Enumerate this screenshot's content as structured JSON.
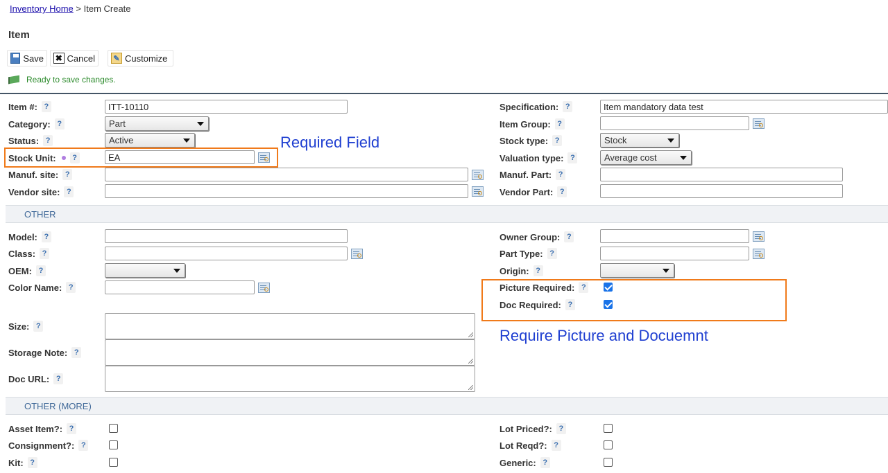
{
  "breadcrumb": {
    "home": "Inventory Home",
    "separator": ">",
    "current": "Item Create"
  },
  "page_title": "Item",
  "toolbar": {
    "save": "Save",
    "cancel": "Cancel",
    "customize": "Customize"
  },
  "status_message": "Ready to save changes.",
  "main": {
    "left": {
      "item_no": {
        "label": "Item #:",
        "value": "ITT-10110"
      },
      "category": {
        "label": "Category:",
        "value": "Part"
      },
      "status": {
        "label": "Status:",
        "value": "Active"
      },
      "stock_unit": {
        "label": "Stock Unit:",
        "value": "EA"
      },
      "manuf_site": {
        "label": "Manuf. site:",
        "value": ""
      },
      "vendor_site": {
        "label": "Vendor site:",
        "value": ""
      }
    },
    "right": {
      "specification": {
        "label": "Specification:",
        "value": "Item mandatory data test"
      },
      "item_group": {
        "label": "Item Group:",
        "value": ""
      },
      "stock_type": {
        "label": "Stock type:",
        "value": "Stock"
      },
      "valuation_type": {
        "label": "Valuation type:",
        "value": "Average cost"
      },
      "manuf_part": {
        "label": "Manuf. Part:",
        "value": ""
      },
      "vendor_part": {
        "label": "Vendor Part:",
        "value": ""
      }
    }
  },
  "other": {
    "title": "OTHER",
    "model": {
      "label": "Model:",
      "value": ""
    },
    "class": {
      "label": "Class:",
      "value": ""
    },
    "oem": {
      "label": "OEM:",
      "value": ""
    },
    "color_name": {
      "label": "Color Name:",
      "value": ""
    },
    "size": {
      "label": "Size:"
    },
    "storage_note": {
      "label": "Storage Note:"
    },
    "doc_url": {
      "label": "Doc URL:"
    },
    "owner_group": {
      "label": "Owner Group:",
      "value": ""
    },
    "part_type": {
      "label": "Part Type:",
      "value": ""
    },
    "origin": {
      "label": "Origin:",
      "value": ""
    },
    "picture_required": {
      "label": "Picture Required:",
      "checked": true
    },
    "doc_required": {
      "label": "Doc Required:",
      "checked": true
    }
  },
  "other_more": {
    "title": "OTHER (MORE)",
    "asset_item": {
      "label": "Asset Item?:",
      "checked": false
    },
    "consignment": {
      "label": "Consignment?:",
      "checked": false
    },
    "kit": {
      "label": "Kit:",
      "checked": false
    },
    "lot_priced": {
      "label": "Lot Priced?:",
      "checked": false
    },
    "lot_reqd": {
      "label": "Lot Reqd?:",
      "checked": false
    },
    "generic": {
      "label": "Generic:",
      "checked": false
    }
  },
  "help_glyph": "?",
  "annotations": {
    "required_field": "Required Field",
    "require_picture_doc": "Require Picture and Docuemnt"
  },
  "colors": {
    "accent_blue": "#1a73e8",
    "annotation_orange": "#f07a1a",
    "annotation_text": "#1f3fd1",
    "status_green": "#2b8a2b",
    "link": "#1a0dab"
  }
}
